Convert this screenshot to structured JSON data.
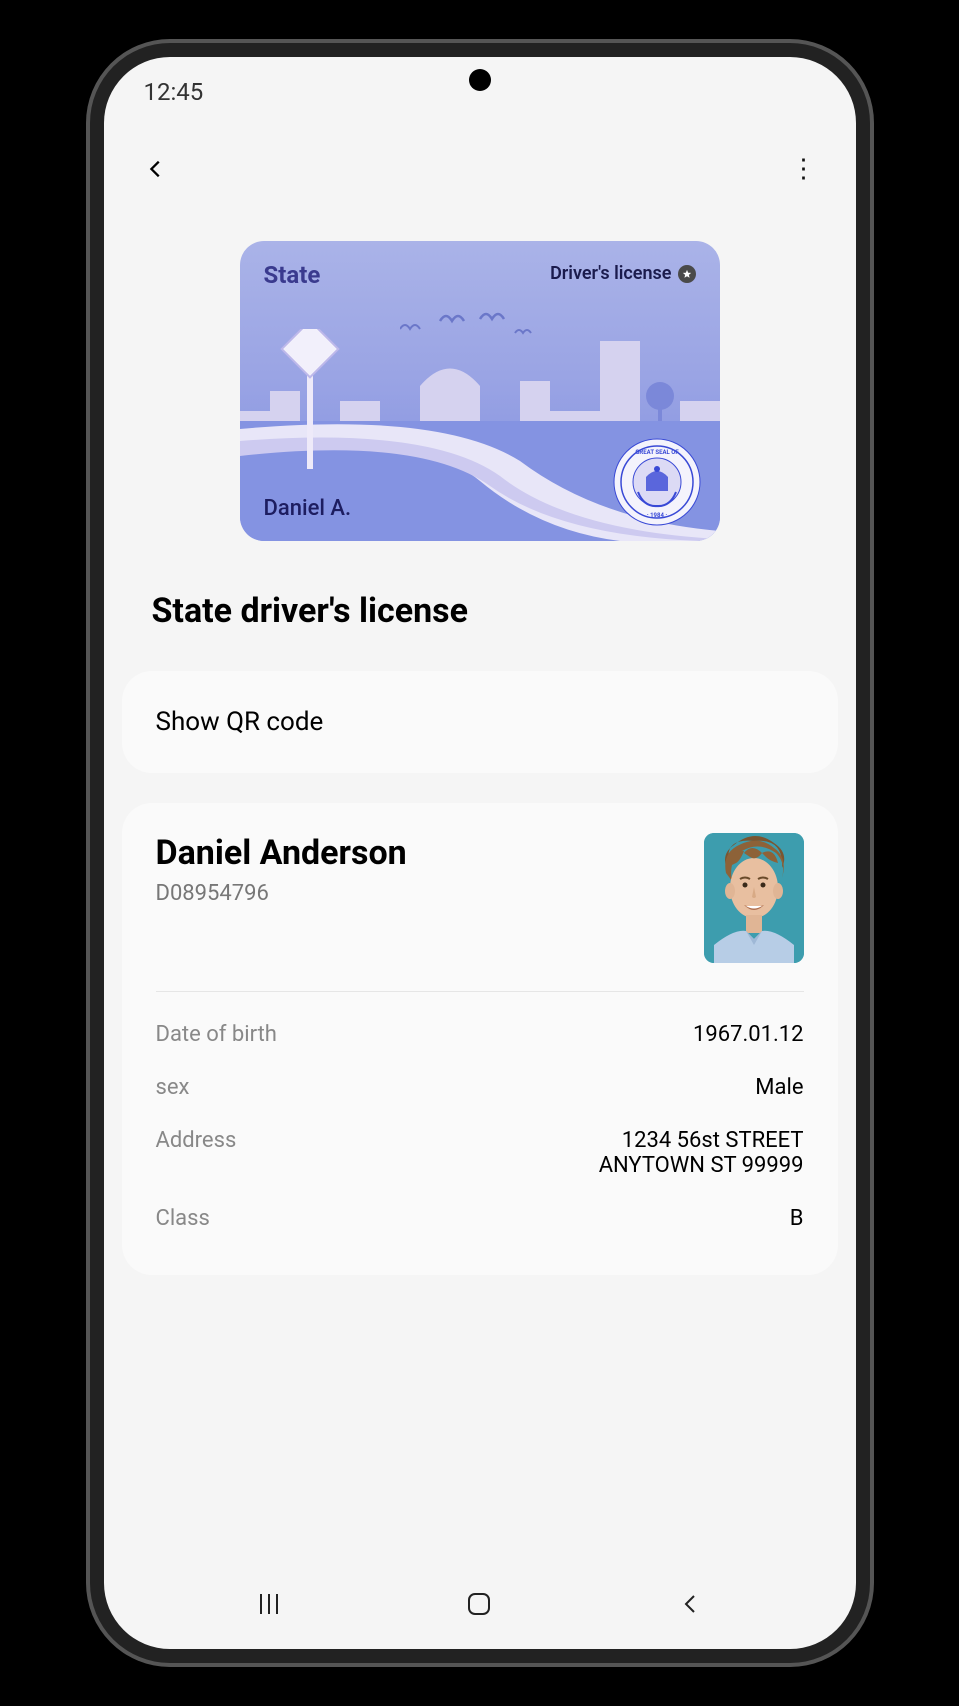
{
  "status": {
    "time": "12:45"
  },
  "card": {
    "state_label": "State",
    "type_label": "Driver's license",
    "holder_short_name": "Daniel A."
  },
  "page": {
    "title": "State driver's license",
    "qr_button_label": "Show QR code"
  },
  "holder": {
    "full_name": "Daniel Anderson",
    "id_number": "D08954796"
  },
  "fields": {
    "dob_label": "Date of birth",
    "dob_value": "1967.01.12",
    "sex_label": "sex",
    "sex_value": "Male",
    "address_label": "Address",
    "address_line1": "1234 56st STREET",
    "address_line2": "ANYTOWN ST 99999",
    "class_label": "Class",
    "class_value": "B"
  }
}
